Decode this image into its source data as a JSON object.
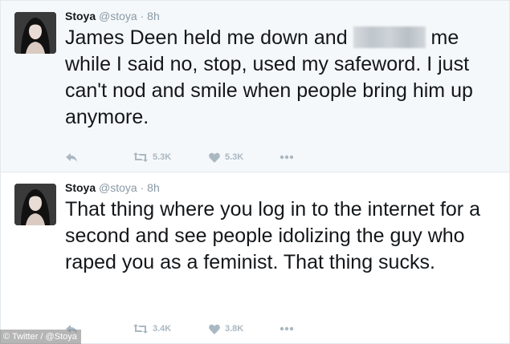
{
  "tweets": [
    {
      "name": "Stoya",
      "handle": "@stoya",
      "separator": "·",
      "time": "8h",
      "text_before": "James Deen held me down and",
      "text_after": "me while I said no, stop, used my safeword. I just can't nod and smile when people bring him up anymore.",
      "retweets": "5.3K",
      "likes": "5.3K"
    },
    {
      "name": "Stoya",
      "handle": "@stoya",
      "separator": "·",
      "time": "8h",
      "text": "That thing where you log in to the internet for a second and see people idolizing the guy who raped you as a feminist. That thing sucks.",
      "retweets": "3.4K",
      "likes": "3.8K"
    }
  ],
  "credit": "© Twitter / @Stoya",
  "icons": [
    "avatar",
    "reply-icon",
    "retweet-icon",
    "heart-icon",
    "more-icon"
  ],
  "colors": {
    "icon": "#aab8c2",
    "meta": "#8899a6",
    "text": "#14171a",
    "highlight_bg": "#f5f8fa"
  }
}
